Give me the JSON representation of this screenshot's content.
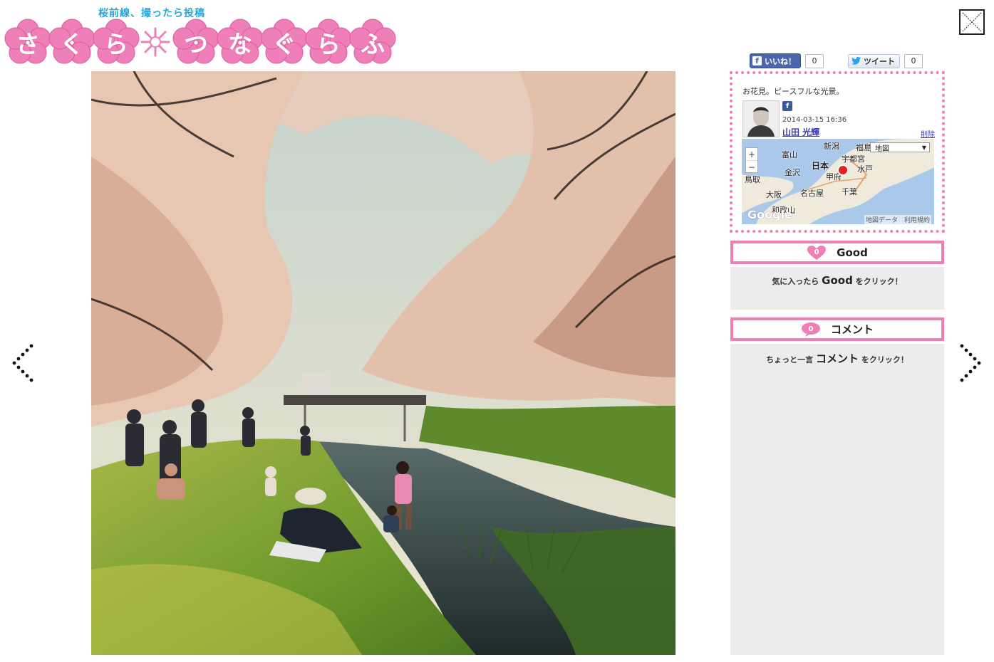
{
  "header": {
    "subtitle": "桜前線、撮ったら投稿",
    "title_chars": [
      "さ",
      "く",
      "ら",
      "つ",
      "な",
      "ぐ",
      "ら",
      "ふ"
    ]
  },
  "close_label": "×",
  "share": {
    "like_label": "いいね！",
    "like_count": "0",
    "tweet_label": "ツイート",
    "tweet_count": "0"
  },
  "post": {
    "caption": "お花見。ピースフルな光景。",
    "date": "2014-03-15 16:36",
    "user": "山田 光輝",
    "delete_label": "削除"
  },
  "map": {
    "type_label": "地図",
    "labels": [
      "新潟",
      "福島",
      "富山",
      "宇都宮",
      "日本",
      "金沢",
      "甲府",
      "水戸",
      "鳥取",
      "名古屋",
      "千葉",
      "大阪",
      "和歌山"
    ],
    "footer": "地図データ　利用規約",
    "brand": "Google"
  },
  "good": {
    "label": "Good",
    "count": "0",
    "hint_pre": "気に入ったら",
    "hint_word": "Good",
    "hint_post": "をクリック！"
  },
  "comment": {
    "label": "コメント",
    "count": "0",
    "hint_pre": "ちょっと一言",
    "hint_word": "コメント",
    "hint_post": "をクリック！"
  },
  "colors": {
    "pink_accent": "#ef7fb5",
    "logo_blue": "#2aa6d6",
    "facebook_blue": "#4a66ad"
  }
}
